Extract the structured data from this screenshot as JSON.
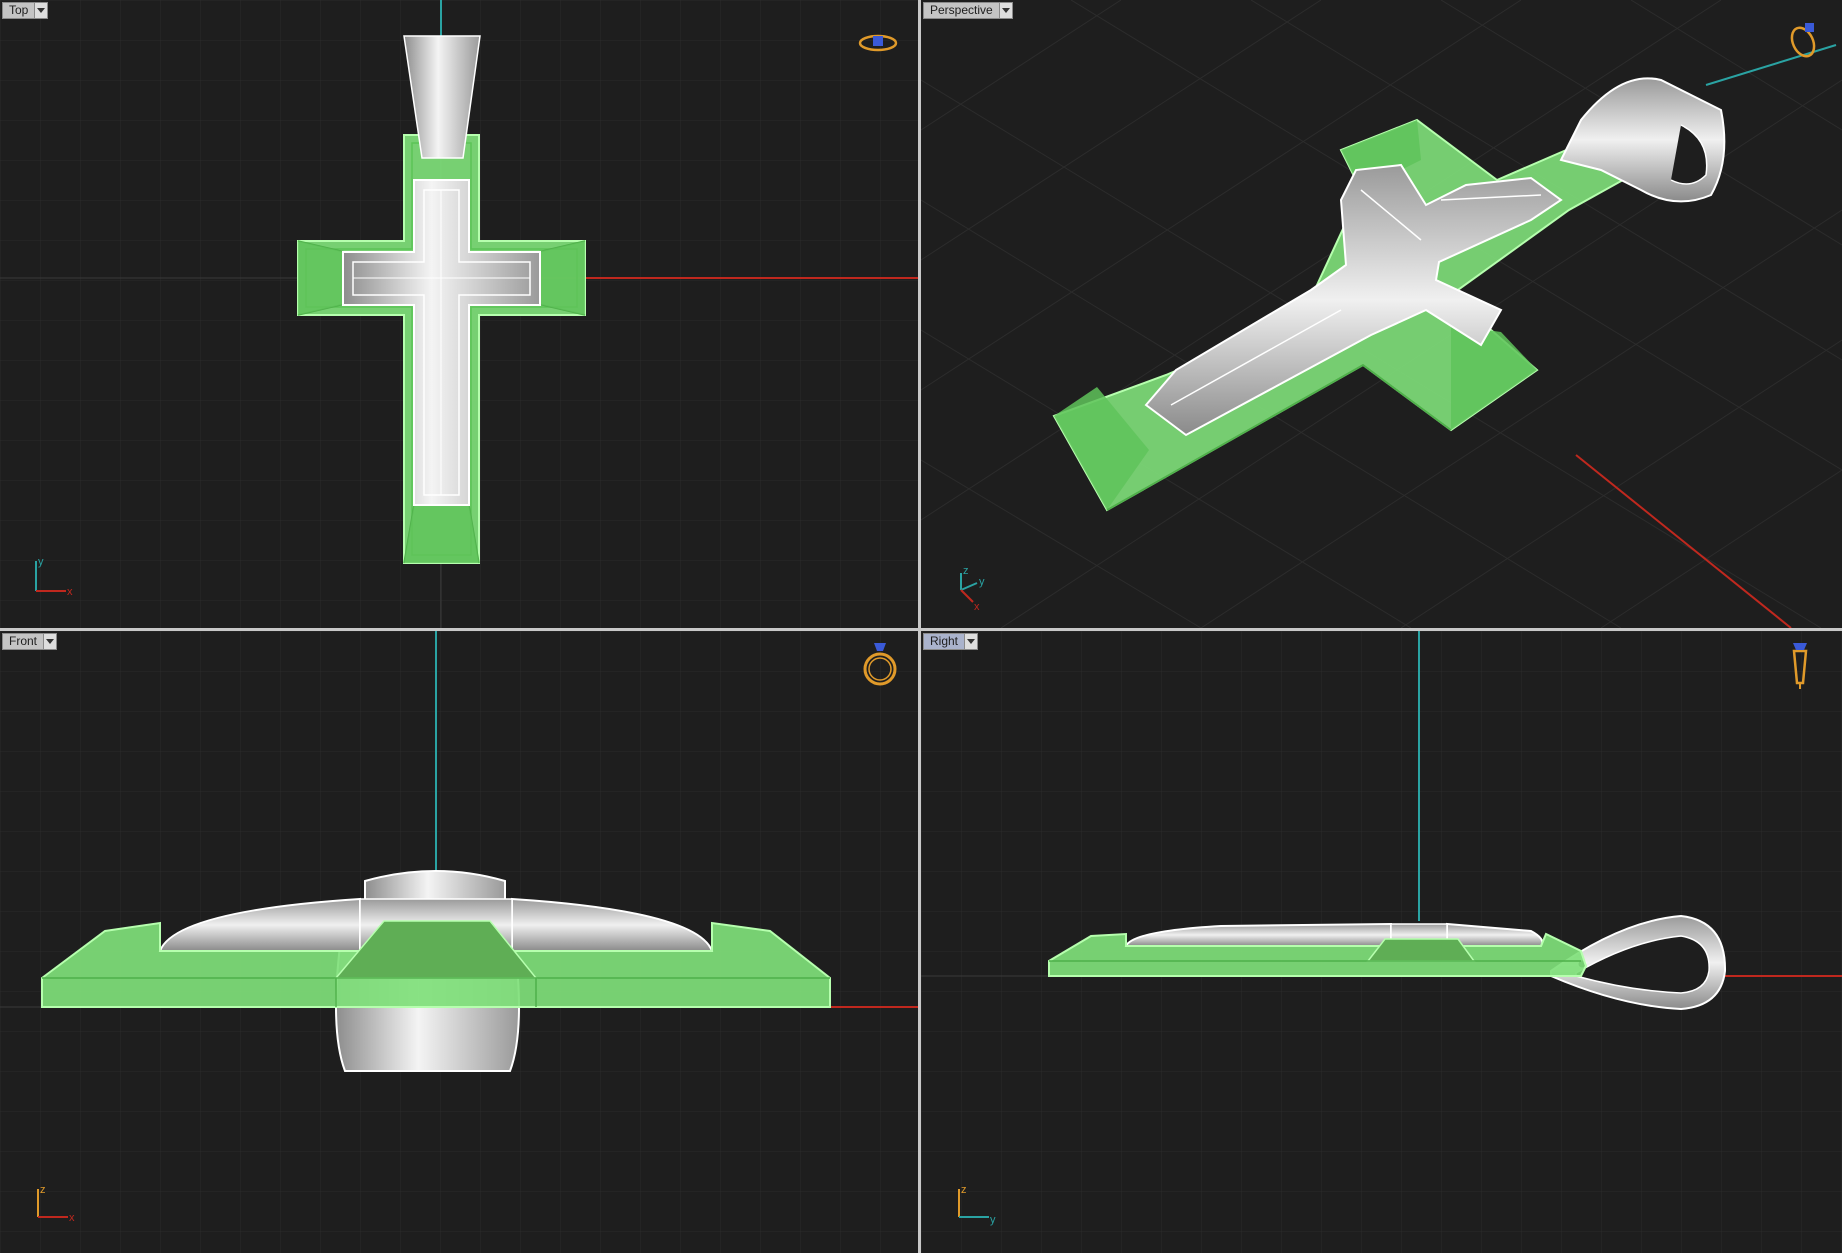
{
  "viewports": {
    "top": {
      "label": "Top",
      "axes": [
        "y",
        "x"
      ],
      "ring_icon": "ring-topview-icon"
    },
    "perspective": {
      "label": "Perspective",
      "axes": [
        "z",
        "y",
        "x"
      ],
      "ring_icon": "ring-perspective-icon"
    },
    "front": {
      "label": "Front",
      "axes": [
        "z",
        "x"
      ],
      "ring_icon": "ring-frontview-icon"
    },
    "right": {
      "label": "Right",
      "axes": [
        "z",
        "y"
      ],
      "ring_icon": "ring-sideview-icon",
      "active": true
    }
  },
  "colors": {
    "background": "#1e1e1e",
    "grid": "#2c2c2c",
    "selection_green": "#7fe07a",
    "selection_edge": "#a6f59c",
    "metal": "#d8d8d8",
    "x_axis": "#c0281e",
    "y_axis": "#2aa3a3",
    "ring_icon": "#e09a2a",
    "gem_icon": "#3a5ad8"
  }
}
